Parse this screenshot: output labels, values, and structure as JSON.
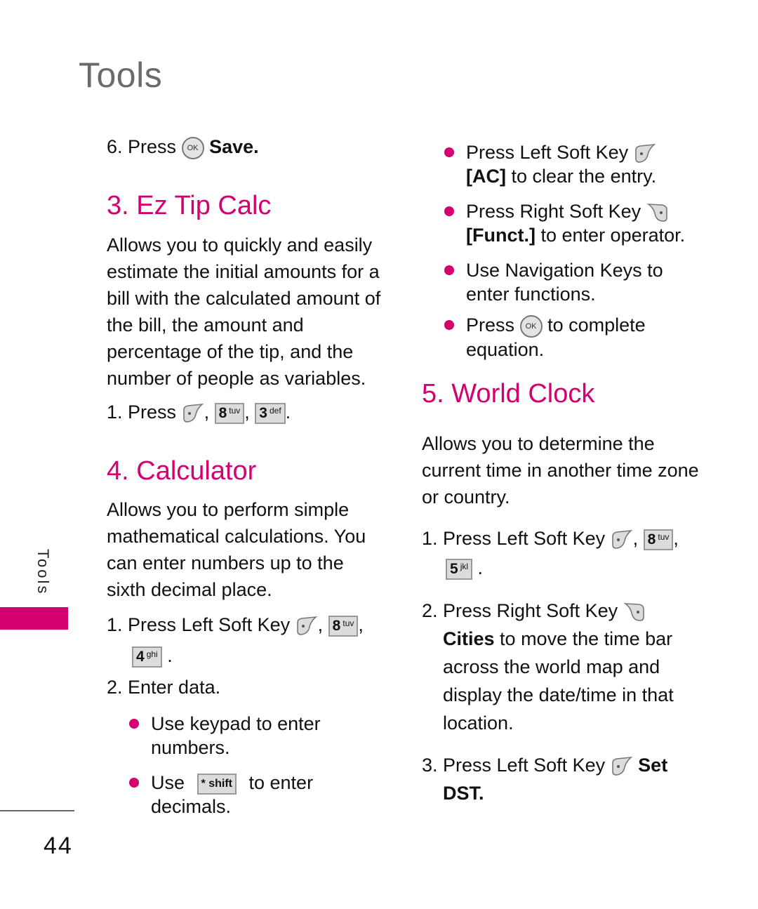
{
  "page": {
    "title": "Tools",
    "side_label": "Tools",
    "page_number": "44",
    "accent_color": "#d4006f"
  },
  "left": {
    "step6": {
      "prefix": "6. Press",
      "key": "OK",
      "action": "Save."
    },
    "ez_tip": {
      "heading": "3. Ez Tip Calc",
      "lines": [
        "Allows you to quickly and easily",
        "estimate the initial amounts for a",
        "bill with the calculated amount of",
        "the bill, the amount and",
        "percentage of the tip, and the",
        "number of people as variables."
      ],
      "step1": {
        "prefix": "1. Press",
        "keys": [
          {
            "num": "8",
            "letters": "tuv"
          },
          {
            "num": "3",
            "letters": "def"
          }
        ]
      }
    },
    "calculator": {
      "heading": "4. Calculator",
      "lines": [
        "Allows you to perform simple",
        "mathematical calculations. You",
        "can enter numbers up to the",
        "sixth decimal place."
      ],
      "step1": {
        "prefix": "1. Press Left Soft Key",
        "keys": [
          {
            "num": "8",
            "letters": "tuv"
          },
          {
            "num": "4",
            "letters": "ghi"
          }
        ]
      },
      "step2": "2. Enter data.",
      "bullets": [
        {
          "line1": "Use keypad to enter",
          "line2": "numbers."
        },
        {
          "pre": "Use",
          "key": "* shift",
          "post": "to enter",
          "line2": "decimals."
        }
      ]
    }
  },
  "right": {
    "bullets": [
      {
        "line1": "Press Left Soft Key",
        "bold": "[AC]",
        "line2": "to clear the entry."
      },
      {
        "line1": "Press Right Soft Key",
        "bold": "[Funct.]",
        "line2": "to enter operator."
      },
      {
        "line1": "Use Navigation Keys to",
        "line2": "enter functions."
      },
      {
        "pre": "Press",
        "key": "OK",
        "post": "to complete",
        "line2": "equation."
      }
    ],
    "world_clock": {
      "heading": "5. World Clock",
      "lines": [
        "Allows you to determine the",
        "current time in another time zone",
        "or country."
      ],
      "step1": {
        "prefix": "1. Press Left Soft Key",
        "keys": [
          {
            "num": "8",
            "letters": "tuv"
          },
          {
            "num": "5",
            "letters": "jkl"
          }
        ]
      },
      "step2": {
        "line1": "2. Press Right Soft Key",
        "bold": "Cities",
        "rest": "to move the time bar",
        "lines": [
          "across the world map and",
          "display the date/time in that",
          "location."
        ]
      },
      "step3": {
        "line1": "3. Press Left Soft Key",
        "bold1": "Set",
        "bold2": "DST."
      }
    }
  }
}
